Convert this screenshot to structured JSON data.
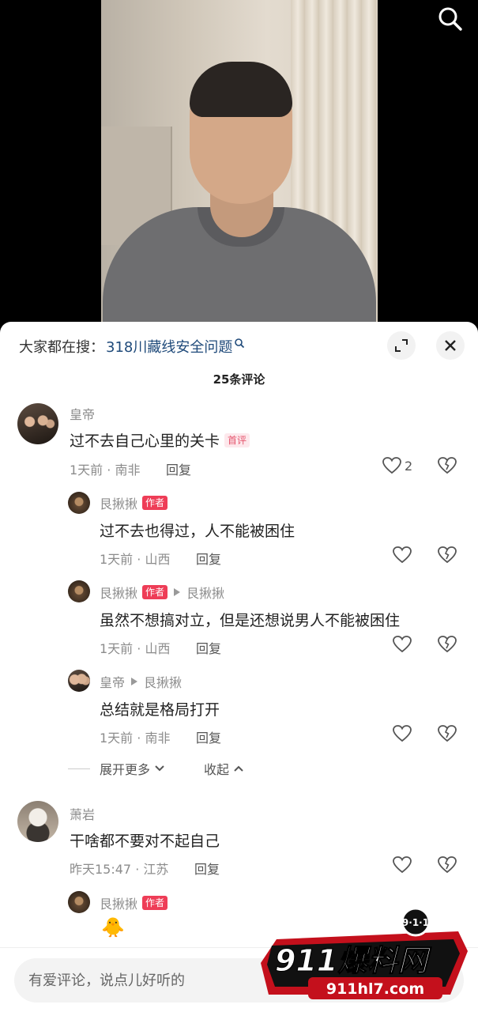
{
  "video": {
    "search_icon": "search-icon"
  },
  "sheet": {
    "hot_search_label": "大家都在搜：",
    "hot_search_term": "318川藏线安全问题",
    "comment_count": "25条评论",
    "expand_icon": "expand-icon",
    "close_icon": "close-icon"
  },
  "comments": [
    {
      "user": "皇帝",
      "badge": "首评",
      "text": "过不去自己心里的关卡",
      "meta": "1天前 · 南非",
      "reply_label": "回复",
      "likes": "2",
      "replies": [
        {
          "user": "艮揪揪",
          "badge": "作者",
          "text": "过不去也得过，人不能被困住",
          "meta": "1天前 · 山西",
          "reply_label": "回复"
        },
        {
          "user": "艮揪揪",
          "badge": "作者",
          "reply_to": "艮揪揪",
          "text": "虽然不想搞对立，但是还想说男人不能被困住",
          "meta": "1天前 · 山西",
          "reply_label": "回复"
        },
        {
          "user": "皇帝",
          "reply_to": "艮揪揪",
          "text": "总结就是格局打开",
          "meta": "1天前 · 南非",
          "reply_label": "回复"
        }
      ],
      "expand_more": "展开更多",
      "collapse": "收起"
    },
    {
      "user": "萧岩",
      "text": "干啥都不要对不起自己",
      "meta": "昨天15:47 · 江苏",
      "reply_label": "回复",
      "replies": [
        {
          "user": "艮揪揪",
          "badge": "作者",
          "emoji": "🐥"
        }
      ]
    }
  ],
  "input": {
    "placeholder": "有爱评论，说点儿好听的"
  },
  "watermark": {
    "brand": "911爆料网",
    "badge": "9·1·1",
    "site": "911hl7.com"
  }
}
